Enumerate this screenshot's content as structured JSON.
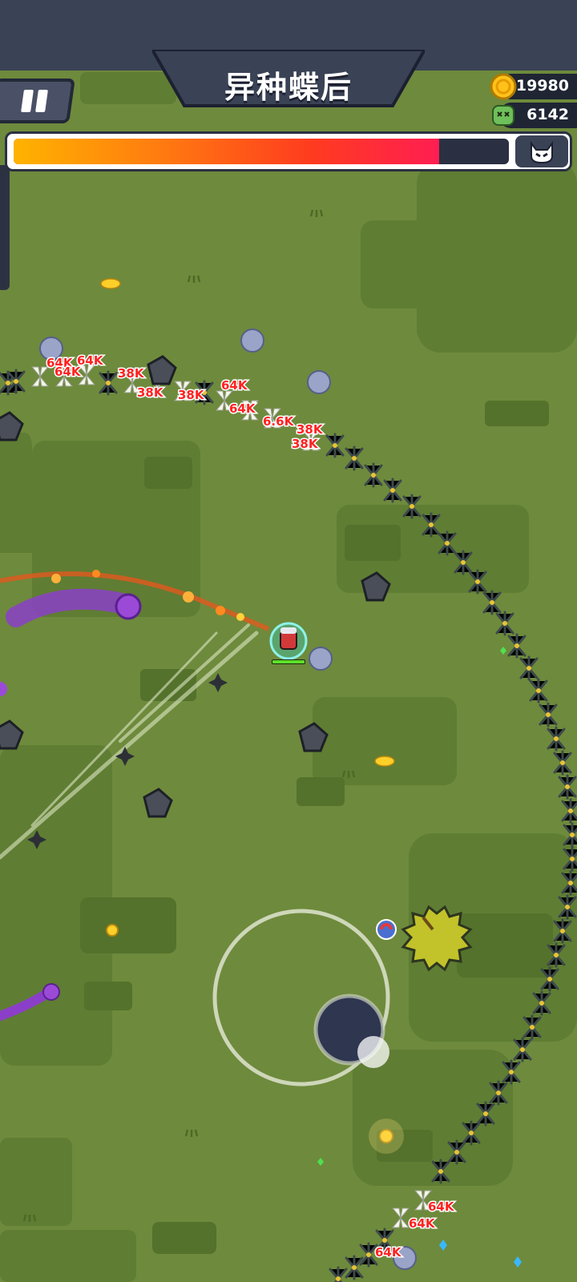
{
  "hud": {
    "boss_name": "异种蝶后",
    "gold": "19980",
    "kills": "6142",
    "boss_hp_fraction": 0.86
  },
  "icons": {
    "pause": "pause-icon",
    "gold": "gold-coin-icon",
    "kills": "skull-kill-icon",
    "boss": "cat-skull-icon"
  },
  "damage_numbers": [
    "64K",
    "64K",
    "64K",
    "38K",
    "38K",
    "38K",
    "64K",
    "64K",
    "6.6K",
    "38K",
    "38K",
    "64K",
    "64K",
    "64K"
  ],
  "colors": {
    "grass": "#6e8a3c",
    "grass_patch": "#5a7a31",
    "hud_dark": "#3a4256",
    "hp_start": "#ffb300",
    "hp_end": "#ff1e52",
    "damage_text": "#ff2222"
  }
}
